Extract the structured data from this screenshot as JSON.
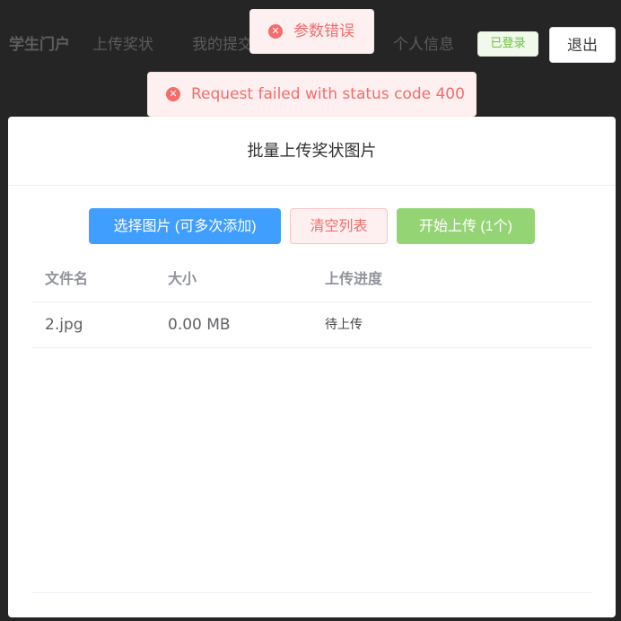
{
  "nav": {
    "brand": "学生门户",
    "items": [
      {
        "label": "上传奖状"
      },
      {
        "label": "我的提交"
      },
      {
        "label": "个人信息"
      }
    ],
    "status_badge": "已登录",
    "logout_label": "退出"
  },
  "toasts": [
    {
      "message": "参数错误",
      "icon": "error-circle-icon"
    },
    {
      "message": "Request failed with status code 400",
      "icon": "error-circle-icon"
    }
  ],
  "dialog": {
    "title": "批量上传奖状图片",
    "buttons": {
      "select": "选择图片 (可多次添加)",
      "clear": "清空列表",
      "start": "开始上传 (1个)"
    },
    "table": {
      "headers": [
        "文件名",
        "大小",
        "上传进度"
      ],
      "rows": [
        {
          "name": "2.jpg",
          "size": "0.00 MB",
          "progress": "待上传"
        }
      ]
    }
  },
  "colors": {
    "primary": "#409eff",
    "danger": "#f56c6c",
    "success": "#67c23a",
    "success_light": "#95d475",
    "nav_bg": "#252525"
  }
}
